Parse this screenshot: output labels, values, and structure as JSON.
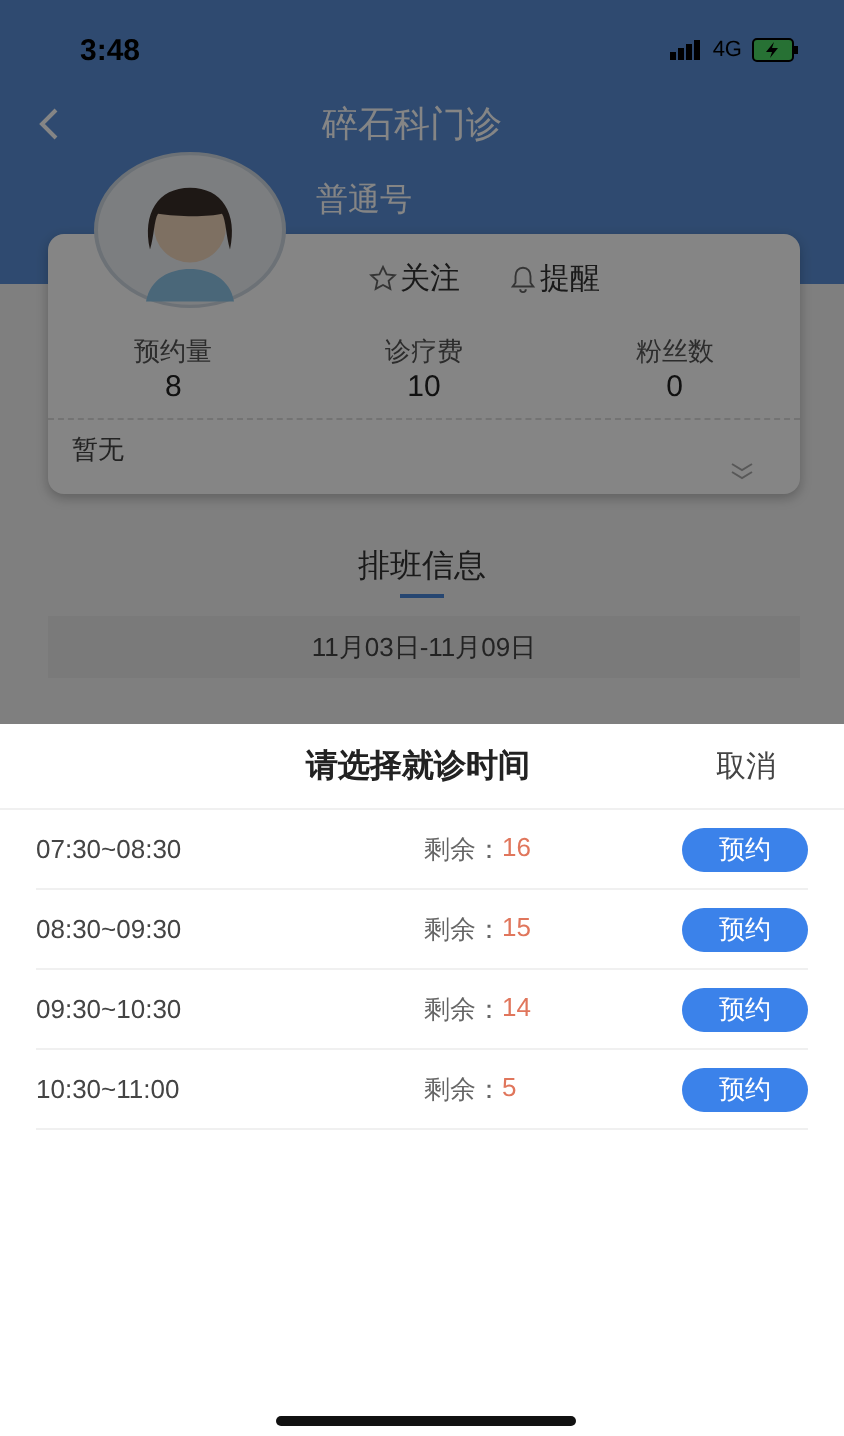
{
  "status_bar": {
    "time": "3:48",
    "network": "4G"
  },
  "header": {
    "title": "碎石科门诊",
    "subtitle": "普通号"
  },
  "doctor_card": {
    "actions": [
      {
        "kind": "follow",
        "label": "关注"
      },
      {
        "kind": "remind",
        "label": "提醒"
      }
    ],
    "stats": [
      {
        "label": "预约量",
        "value": "8"
      },
      {
        "label": "诊疗费",
        "value": "10"
      },
      {
        "label": "粉丝数",
        "value": "0"
      }
    ],
    "intro": "暂无"
  },
  "schedule": {
    "title": "排班信息",
    "date_range": "11月03日-11月09日"
  },
  "time_sheet": {
    "title": "请选择就诊时间",
    "cancel": "取消",
    "slots": [
      {
        "time": "07:30~08:30",
        "remaining_label": "剩余：",
        "remaining": "16",
        "button": "预约"
      },
      {
        "time": "08:30~09:30",
        "remaining_label": "剩余：",
        "remaining": "15",
        "button": "预约"
      },
      {
        "time": "09:30~10:30",
        "remaining_label": "剩余：",
        "remaining": "14",
        "button": "预约"
      },
      {
        "time": "10:30~11:00",
        "remaining_label": "剩余：",
        "remaining": "5",
        "button": "预约"
      }
    ]
  }
}
